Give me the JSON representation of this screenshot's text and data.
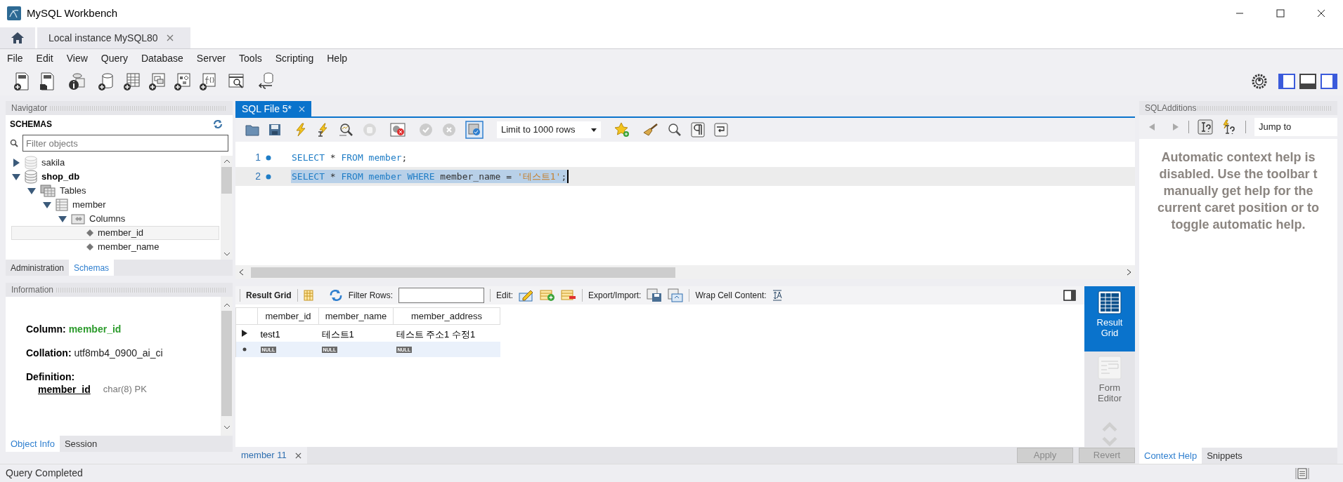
{
  "window": {
    "title": "MySQL Workbench"
  },
  "connection_tab": {
    "label": "Local instance MySQL80"
  },
  "menu": [
    "File",
    "Edit",
    "View",
    "Query",
    "Database",
    "Server",
    "Tools",
    "Scripting",
    "Help"
  ],
  "navigator": {
    "title": "Navigator",
    "section": "SCHEMAS",
    "filter": {
      "placeholder": "Filter objects"
    },
    "tree": [
      {
        "label": "sakila",
        "kind": "schema",
        "default": false,
        "expanded": false,
        "selected": false
      },
      {
        "label": "shop_db",
        "kind": "schema",
        "default": true,
        "expanded": true,
        "selected": false,
        "children": [
          {
            "label": "Tables",
            "kind": "tables",
            "expanded": true,
            "selected": false,
            "children": [
              {
                "label": "member",
                "kind": "table",
                "expanded": true,
                "selected": false,
                "children": [
                  {
                    "label": "Columns",
                    "kind": "columns",
                    "expanded": true,
                    "selected": false,
                    "children": [
                      {
                        "label": "member_id",
                        "kind": "column",
                        "selected": true
                      },
                      {
                        "label": "member_name",
                        "kind": "column",
                        "selected": false
                      }
                    ]
                  }
                ]
              }
            ]
          }
        ]
      }
    ],
    "tabs": [
      {
        "label": "Administration",
        "selected": false
      },
      {
        "label": "Schemas",
        "selected": true
      }
    ]
  },
  "information": {
    "title": "Information",
    "column": {
      "label": "Column:",
      "value": "member_id"
    },
    "collation": {
      "label": "Collation:",
      "value": "utf8mb4_0900_ai_ci"
    },
    "definition": {
      "label": "Definition:",
      "name": "member_id",
      "type": "char(8) PK"
    },
    "tabs": [
      {
        "label": "Object Info",
        "selected": true
      },
      {
        "label": "Session",
        "selected": false
      }
    ]
  },
  "editor": {
    "tab": {
      "label": "SQL File 5*"
    },
    "limit": "Limit to 1000 rows",
    "lines": [
      {
        "number": "1",
        "selected": false,
        "tokens": [
          {
            "kind": "keyword",
            "text": "SELECT"
          },
          {
            "kind": "plain",
            "text": " * "
          },
          {
            "kind": "keyword",
            "text": "FROM "
          },
          {
            "kind": "identifier",
            "text": "member"
          },
          {
            "kind": "plain",
            "text": ";"
          }
        ]
      },
      {
        "number": "2",
        "selected": true,
        "tokens": [
          {
            "kind": "keyword",
            "text": "SELECT"
          },
          {
            "kind": "plain",
            "text": " * "
          },
          {
            "kind": "keyword",
            "text": "FROM "
          },
          {
            "kind": "identifier",
            "text": "member "
          },
          {
            "kind": "keyword",
            "text": "WHERE"
          },
          {
            "kind": "plain",
            "text": " member_name = "
          },
          {
            "kind": "string",
            "text": "'테스트1'"
          },
          {
            "kind": "plain",
            "text": ";"
          }
        ]
      }
    ]
  },
  "results": {
    "toolbar": {
      "title": "Result Grid",
      "filter_label": "Filter Rows:",
      "edit_label": "Edit:",
      "export_label": "Export/Import:",
      "wrap_label": "Wrap Cell Content:"
    },
    "columns": [
      "member_id",
      "member_name",
      "member_address"
    ],
    "rows": [
      {
        "kind": "data",
        "cells": [
          "test1",
          "테스트1",
          "테스트 주소1 수정1"
        ]
      },
      {
        "kind": "new",
        "cells": [
          "NULL",
          "NULL",
          "NULL"
        ]
      }
    ],
    "views": [
      {
        "label": "Result Grid",
        "selected": true
      },
      {
        "label": "Form Editor",
        "selected": false
      }
    ],
    "tab": {
      "label": "member 11"
    },
    "buttons": [
      {
        "label": "Apply",
        "disabled": true
      },
      {
        "label": "Revert",
        "disabled": true
      }
    ]
  },
  "sql_additions": {
    "title": "SQLAdditions",
    "jump_to": "Jump to",
    "help_lines": [
      "Automatic context help is",
      "disabled. Use the toolbar t",
      "manually get help for the",
      "current caret position or to",
      "toggle automatic help."
    ],
    "tabs": [
      {
        "label": "Context Help",
        "selected": true
      },
      {
        "label": "Snippets",
        "selected": false
      }
    ]
  },
  "status_bar": "Query Completed"
}
